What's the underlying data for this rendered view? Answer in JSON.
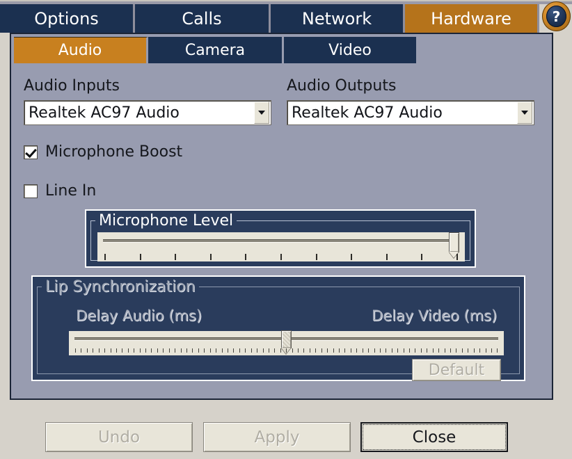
{
  "window": {
    "background_color": "#d6d2ca",
    "panel_color": "#989cb0",
    "accent_orange": "#c8801f",
    "tab_navy": "#1b3050",
    "group_navy": "#2a3c5c"
  },
  "help_button": {
    "glyph": "?",
    "name": "help-icon"
  },
  "main_tabs": [
    {
      "label": "Options",
      "active": false
    },
    {
      "label": "Calls",
      "active": false
    },
    {
      "label": "Network",
      "active": false
    },
    {
      "label": "Hardware",
      "active": true
    }
  ],
  "sub_tabs": [
    {
      "label": "Audio",
      "active": true
    },
    {
      "label": "Camera",
      "active": false
    },
    {
      "label": "Video",
      "active": false
    }
  ],
  "audio_inputs": {
    "label": "Audio Inputs",
    "value": "Realtek AC97 Audio",
    "options": [
      "Realtek AC97 Audio"
    ]
  },
  "audio_outputs": {
    "label": "Audio Outputs",
    "value": "Realtek AC97 Audio",
    "options": [
      "Realtek AC97 Audio"
    ]
  },
  "microphone_boost": {
    "label": "Microphone Boost",
    "checked": true
  },
  "line_in": {
    "label": "Line In",
    "checked": false
  },
  "microphone_level": {
    "title": "Microphone Level",
    "value_percent": 100,
    "enabled": true,
    "tick_count": 11
  },
  "lip_sync": {
    "title": "Lip Synchronization",
    "enabled": false,
    "delay_audio_label": "Delay Audio (ms)",
    "delay_video_label": "Delay Video (ms)",
    "slider_percent": 50,
    "default_button": "Default"
  },
  "footer_buttons": [
    {
      "label": "Undo",
      "enabled": false,
      "focused": false
    },
    {
      "label": "Apply",
      "enabled": false,
      "focused": false
    },
    {
      "label": "Close",
      "enabled": true,
      "focused": true
    }
  ]
}
